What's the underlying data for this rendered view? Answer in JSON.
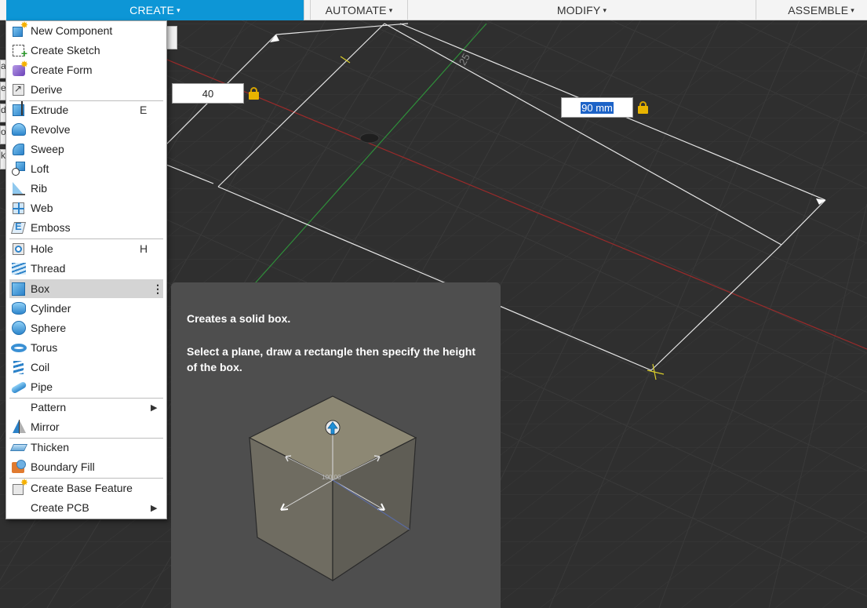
{
  "toolbar": {
    "tabs": [
      {
        "label": "CREATE",
        "active": true
      },
      {
        "label": "AUTOMATE",
        "active": false
      },
      {
        "label": "MODIFY",
        "active": false
      },
      {
        "label": "ASSEMBLE",
        "active": false
      }
    ],
    "caret": "▾",
    "accent_color": "#0d96d6"
  },
  "left_panel_fragments": [
    "a",
    "e",
    "d",
    "or",
    "k"
  ],
  "viewport": {
    "background": "#2f2f2f",
    "axis_label": "25",
    "dimension_inputs": [
      {
        "value": "40",
        "selected": false,
        "locked": true
      },
      {
        "value": "90 mm",
        "selected": true,
        "locked": true
      }
    ]
  },
  "menu": {
    "items": [
      {
        "label": "New Component",
        "icon": "new-component-icon",
        "shortcut": ""
      },
      {
        "label": "Create Sketch",
        "icon": "create-sketch-icon",
        "shortcut": ""
      },
      {
        "label": "Create Form",
        "icon": "create-form-icon",
        "shortcut": ""
      },
      {
        "label": "Derive",
        "icon": "derive-icon",
        "shortcut": ""
      },
      {
        "label": "Extrude",
        "icon": "extrude-icon",
        "shortcut": "E"
      },
      {
        "label": "Revolve",
        "icon": "revolve-icon",
        "shortcut": ""
      },
      {
        "label": "Sweep",
        "icon": "sweep-icon",
        "shortcut": ""
      },
      {
        "label": "Loft",
        "icon": "loft-icon",
        "shortcut": ""
      },
      {
        "label": "Rib",
        "icon": "rib-icon",
        "shortcut": ""
      },
      {
        "label": "Web",
        "icon": "web-icon",
        "shortcut": ""
      },
      {
        "label": "Emboss",
        "icon": "emboss-icon",
        "shortcut": ""
      },
      {
        "label": "Hole",
        "icon": "hole-icon",
        "shortcut": "H"
      },
      {
        "label": "Thread",
        "icon": "thread-icon",
        "shortcut": ""
      },
      {
        "label": "Box",
        "icon": "box-icon",
        "shortcut": "",
        "highlighted": true
      },
      {
        "label": "Cylinder",
        "icon": "cylinder-icon",
        "shortcut": ""
      },
      {
        "label": "Sphere",
        "icon": "sphere-icon",
        "shortcut": ""
      },
      {
        "label": "Torus",
        "icon": "torus-icon",
        "shortcut": ""
      },
      {
        "label": "Coil",
        "icon": "coil-icon",
        "shortcut": ""
      },
      {
        "label": "Pipe",
        "icon": "pipe-icon",
        "shortcut": ""
      },
      {
        "label": "Pattern",
        "icon": "",
        "shortcut": "",
        "submenu": true
      },
      {
        "label": "Mirror",
        "icon": "mirror-icon",
        "shortcut": ""
      },
      {
        "label": "Thicken",
        "icon": "thicken-icon",
        "shortcut": ""
      },
      {
        "label": "Boundary Fill",
        "icon": "boundary-fill-icon",
        "shortcut": ""
      },
      {
        "label": "Create Base Feature",
        "icon": "create-base-feature-icon",
        "shortcut": ""
      },
      {
        "label": "Create PCB",
        "icon": "",
        "shortcut": "",
        "submenu": true
      }
    ],
    "submenu_arrow": "▶",
    "more_glyph": "⋮"
  },
  "tooltip": {
    "title": "Creates a solid box.",
    "description": "Select a plane, draw a rectangle then specify the height of the box.",
    "illustration_label": "100.00"
  }
}
